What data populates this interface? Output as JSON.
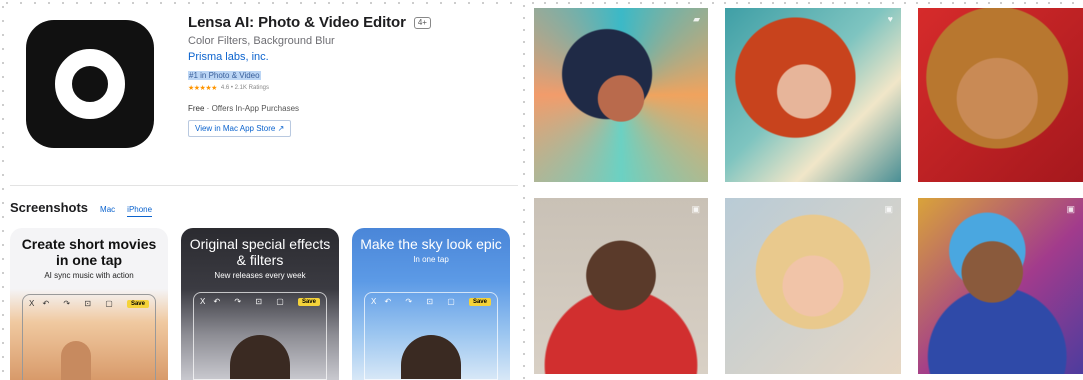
{
  "app": {
    "title": "Lensa AI: Photo & Video Editor",
    "age_rating": "4+",
    "subtitle": "Color Filters, Background Blur",
    "developer": "Prisma labs, inc.",
    "rank": "#1 in Photo & Video",
    "stars": "★★★★★",
    "rating_text": "4.6 • 2.1K Ratings",
    "price": "Free",
    "iap_text": " · Offers In-App Purchases",
    "mac_button": "View in Mac App Store ↗"
  },
  "screenshots": {
    "heading": "Screenshots",
    "tabs": [
      {
        "label": "Mac"
      },
      {
        "label": "iPhone"
      }
    ],
    "cards": [
      {
        "heading": "Create short movies in one tap",
        "sub": "AI sync music with action",
        "tb_left": "X",
        "tb_icons": "↶ ↷ ⊡ ▢",
        "save": "Save"
      },
      {
        "heading": "Original special effects & filters",
        "sub": "New releases every week",
        "tb_left": "X",
        "tb_icons": "↶ ↷ ⊡ ▢",
        "save": "Save"
      },
      {
        "heading": "Make the sky look epic",
        "sub": "In one tap",
        "tb_left": "X",
        "tb_icons": "↶ ↷ ⊡ ▢",
        "save": "Save"
      }
    ]
  },
  "gallery": {
    "icons": [
      "bookmark-icon",
      "heart-icon",
      "",
      "camera-icon",
      "camera-icon",
      "camera-icon"
    ],
    "glyphs": [
      "▰",
      "♥",
      "",
      "▣",
      "▣",
      "▣"
    ]
  }
}
